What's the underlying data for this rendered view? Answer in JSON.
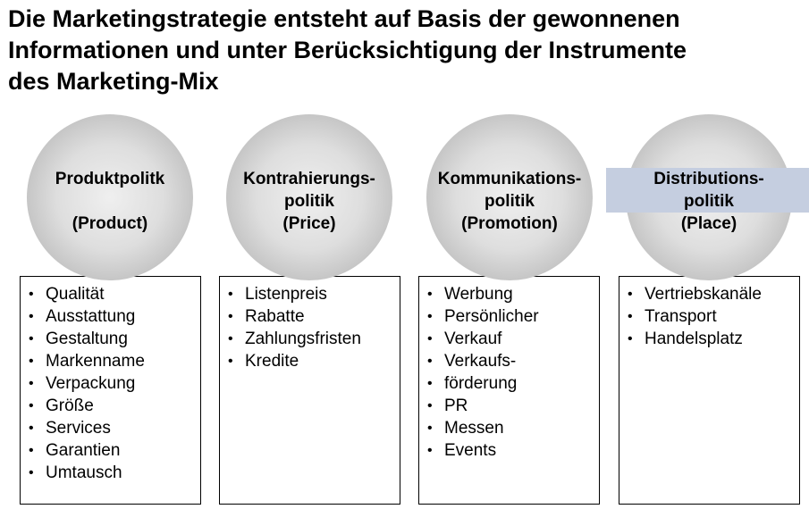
{
  "title": {
    "line1": "Die Marketingstrategie entsteht auf Basis der gewonnenen",
    "line2": "Informationen und unter Berücksichtigung der Instrumente",
    "line3": "des Marketing-Mix"
  },
  "columns": [
    {
      "heading1": "Produktpolitk",
      "heading2": "",
      "heading3": "(Product)",
      "items": [
        "Qualität",
        "Ausstattung",
        "Gestaltung",
        "Markenname",
        "Verpackung",
        "Größe",
        "Services",
        "Garantien",
        "Umtausch"
      ]
    },
    {
      "heading1": "Kontrahierungs-",
      "heading2": "politik",
      "heading3": "(Price)",
      "items": [
        "Listenpreis",
        "Rabatte",
        "Zahlungsfristen",
        "Kredite"
      ]
    },
    {
      "heading1": "Kommunikations-",
      "heading2": "politik",
      "heading3": "(Promotion)",
      "items": [
        "Werbung",
        "Persönlicher",
        "Verkauf",
        "Verkaufs-",
        "förderung",
        "PR",
        "Messen",
        "Events"
      ]
    },
    {
      "heading1": "Distributions-",
      "heading2": "politik",
      "heading3": "(Place)",
      "items": [
        "Vertriebskanäle",
        "Transport",
        "Handelsplatz"
      ]
    }
  ],
  "colors": {
    "highlight": "#c5cee0",
    "circle_fill": "#d9d9d9",
    "border": "#000000"
  }
}
